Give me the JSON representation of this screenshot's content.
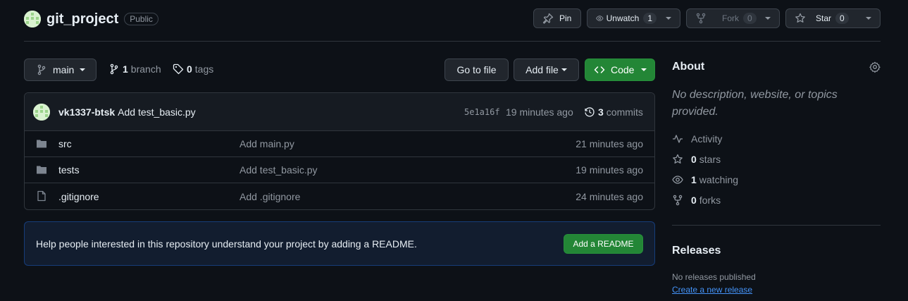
{
  "repo": {
    "name": "git_project",
    "visibility": "Public"
  },
  "actions": {
    "pin_label": "Pin",
    "unwatch_label": "Unwatch",
    "watch_count": "1",
    "fork_label": "Fork",
    "fork_count": "0",
    "star_label": "Star",
    "star_count": "0"
  },
  "toolbar": {
    "branch_name": "main",
    "branch_count": "1",
    "branch_label": "branch",
    "tag_count": "0",
    "tag_label": "tags",
    "goto_file_label": "Go to file",
    "add_file_label": "Add file",
    "code_label": "Code"
  },
  "commit": {
    "author": "vk1337-btsk",
    "message": "Add test_basic.py",
    "sha": "5e1a16f",
    "time": "19 minutes ago",
    "commit_count": "3",
    "commits_label": "commits"
  },
  "files": [
    {
      "type": "folder",
      "name": "src",
      "message": "Add main.py",
      "time": "21 minutes ago"
    },
    {
      "type": "folder",
      "name": "tests",
      "message": "Add test_basic.py",
      "time": "19 minutes ago"
    },
    {
      "type": "file",
      "name": ".gitignore",
      "message": "Add .gitignore",
      "time": "24 minutes ago"
    }
  ],
  "readme_banner": {
    "text": "Help people interested in this repository understand your project by adding a README.",
    "button_label": "Add a README"
  },
  "about": {
    "title": "About",
    "description": "No description, website, or topics provided.",
    "activity_label": "Activity",
    "stars_count": "0",
    "stars_label": "stars",
    "watching_count": "1",
    "watching_label": "watching",
    "forks_count": "0",
    "forks_label": "forks"
  },
  "releases": {
    "title": "Releases",
    "empty_text": "No releases published",
    "create_link": "Create a new release"
  },
  "colors": {
    "background": "#0d1117",
    "primary_green": "#238636",
    "link_blue": "#4493f8",
    "muted_text": "#9198a1"
  }
}
